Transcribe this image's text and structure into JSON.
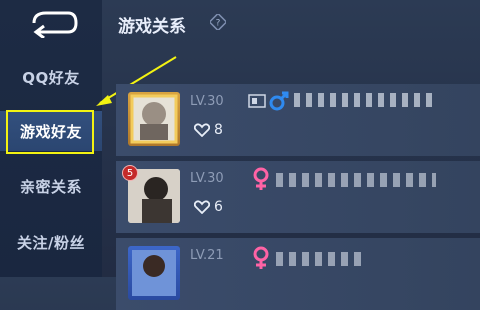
{
  "header": {
    "title": "游戏关系"
  },
  "sidebar": {
    "items": [
      {
        "label": "QQ好友"
      },
      {
        "label": "游戏好友"
      },
      {
        "label": "亲密关系"
      },
      {
        "label": "关注/粉丝"
      }
    ]
  },
  "friends": [
    {
      "level": "LV.30",
      "likes": "8",
      "gender": "male",
      "gender_color": "#2f8af0"
    },
    {
      "level": "LV.30",
      "likes": "6",
      "gender": "female",
      "gender_color": "#ff63a5",
      "rank_badge": "5"
    },
    {
      "level": "LV.21",
      "likes": "",
      "gender": "female",
      "gender_color": "#ff63a5"
    }
  ],
  "colors": {
    "highlight": "#f3f312",
    "active_tab": "#2f4a77"
  }
}
